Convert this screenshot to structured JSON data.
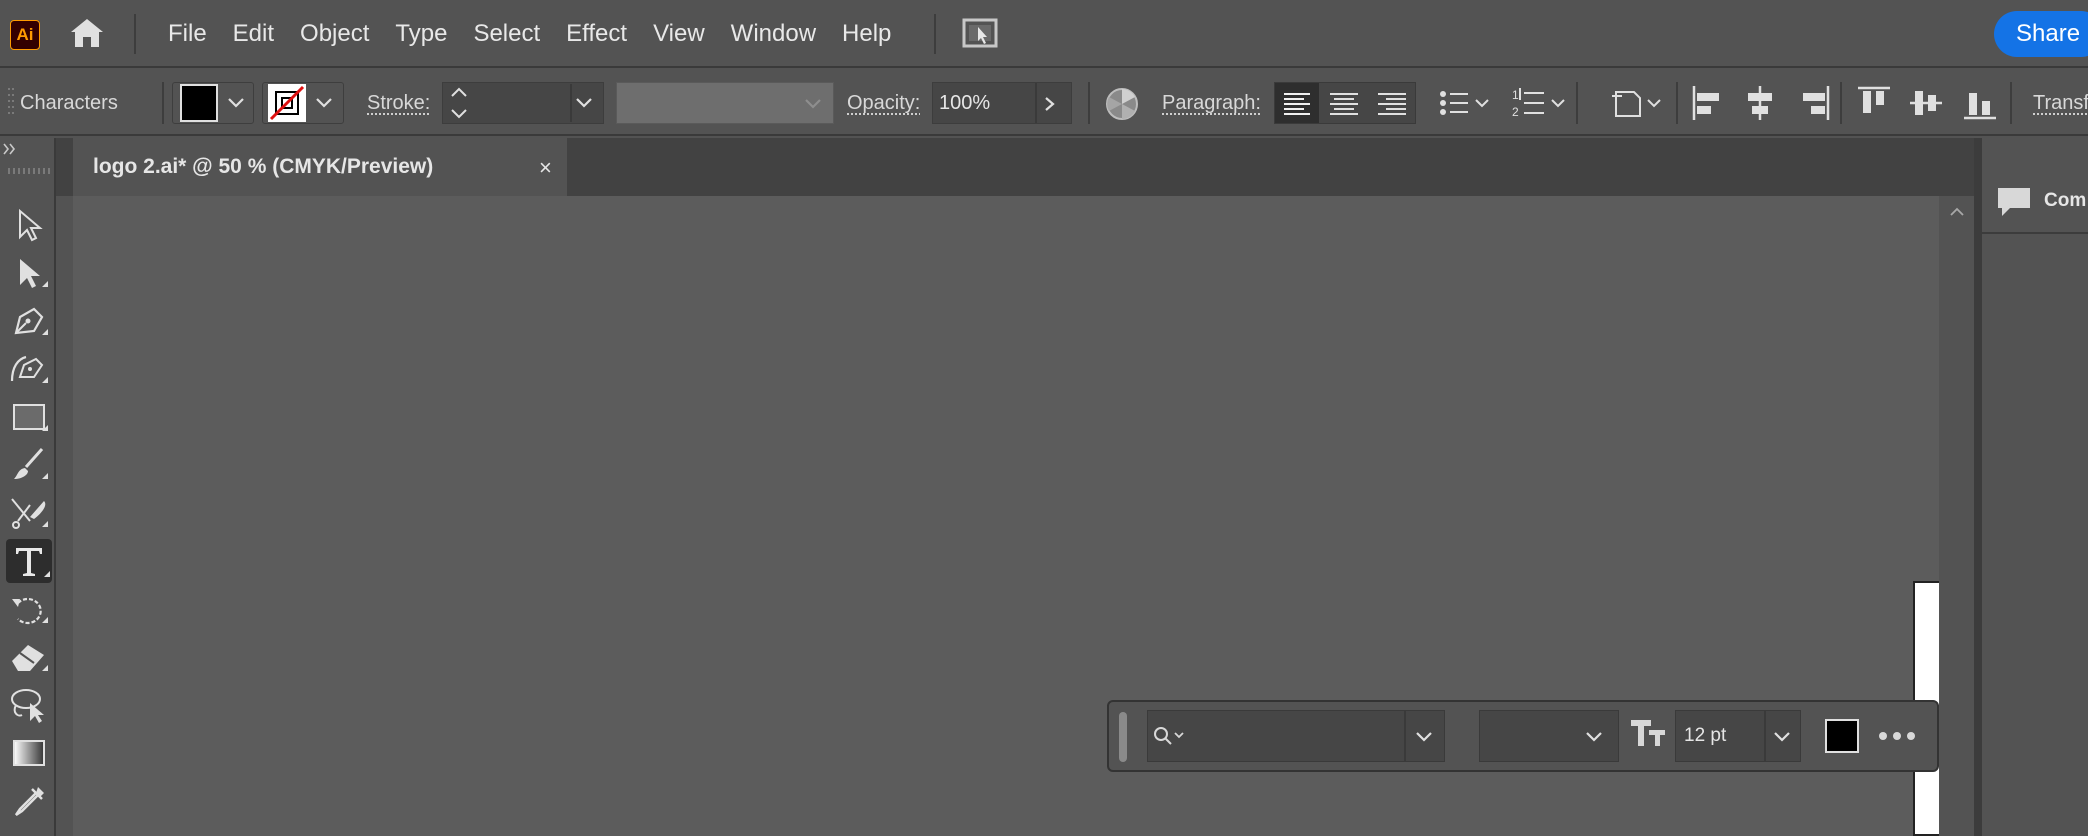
{
  "app": {
    "logo_text": "Ai",
    "accent_color": "#ff9a00",
    "share_label": "Share"
  },
  "menu": {
    "items": [
      "File",
      "Edit",
      "Object",
      "Type",
      "Select",
      "Effect",
      "View",
      "Window",
      "Help"
    ]
  },
  "control_bar": {
    "context_label": "Characters",
    "fill_color": "#000000",
    "stroke_label": "Stroke:",
    "stroke_value": "",
    "opacity_label": "Opacity:",
    "opacity_value": "100%",
    "paragraph_label": "Paragraph:",
    "transform_label": "Transf"
  },
  "document": {
    "tab_title": "logo 2.ai* @ 50 % (CMYK/Preview)",
    "close_glyph": "×"
  },
  "right_panel": {
    "comments_label": "Com"
  },
  "task_bar": {
    "font_family": "",
    "font_style": "",
    "font_size": "12 pt",
    "fill_color": "#000000"
  },
  "tools": {
    "items": [
      "selection-tool",
      "direct-selection-tool",
      "pen-tool",
      "curvature-tool",
      "rectangle-tool",
      "paintbrush-tool",
      "scissors-tool",
      "type-tool",
      "rotate-tool",
      "eraser-tool",
      "lasso-tool",
      "gradient-tool",
      "eyedropper-tool"
    ],
    "active": "type-tool"
  }
}
